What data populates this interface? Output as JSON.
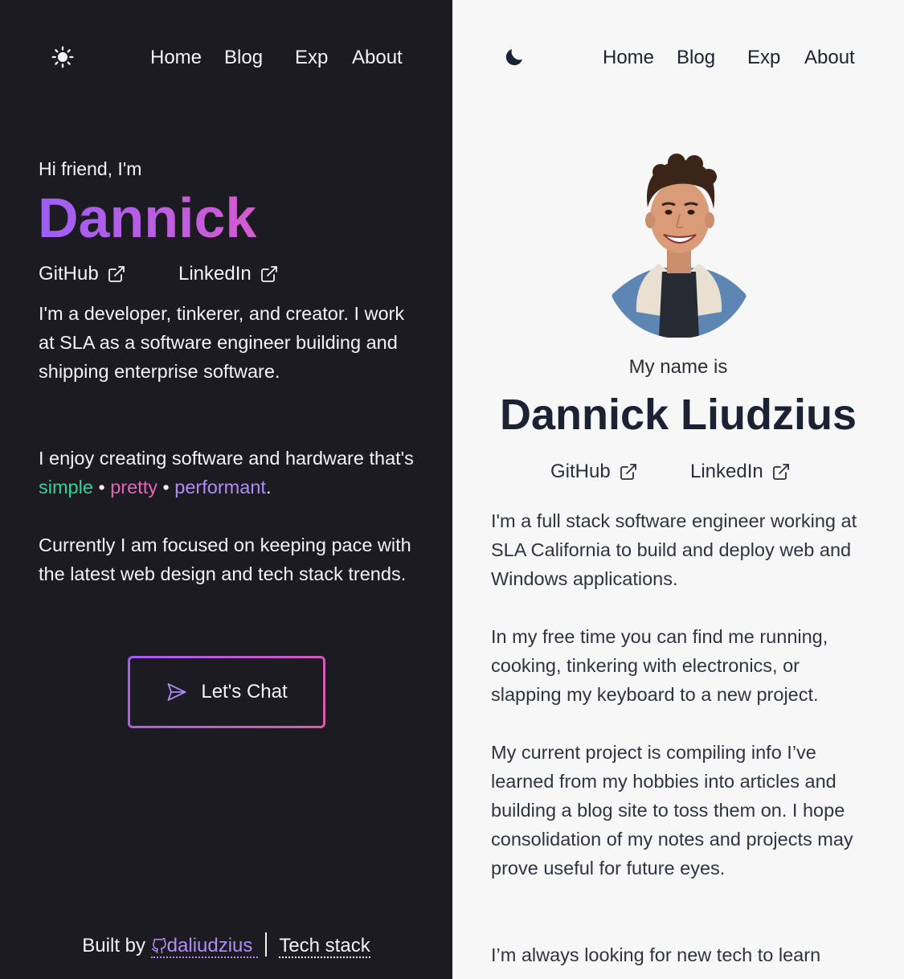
{
  "dark_panel": {
    "theme_toggle_icon": "sun-icon",
    "nav": [
      "Home",
      "Blog",
      "Exp",
      "About"
    ],
    "greeting": "Hi friend, I'm",
    "name": "Dannick",
    "links": [
      {
        "label": "GitHub",
        "icon": "external-link-icon"
      },
      {
        "label": "LinkedIn",
        "icon": "external-link-icon"
      }
    ],
    "bio": "I'm a developer, tinkerer, and creator. I work at SLA as a software engineer building and shipping enterprise software.",
    "enjoy_prefix": "I enjoy creating software and hardware that's",
    "qualities": [
      "simple",
      "pretty",
      "performant"
    ],
    "quality_separator": "•",
    "enjoy_suffix": ".",
    "focus": "Currently I am focused on keeping pace with the latest web design and tech stack trends.",
    "cta": {
      "label": "Let's Chat",
      "icon": "send-icon"
    },
    "footer": {
      "built_by": "Built by",
      "github_user": "daliudzius",
      "github_icon": "github-icon",
      "tech_stack": "Tech stack"
    }
  },
  "light_panel": {
    "theme_toggle_icon": "moon-icon",
    "nav": [
      "Home",
      "Blog",
      "Exp",
      "About"
    ],
    "intro": "My name is",
    "full_name": "Dannick Liudzius",
    "links": [
      {
        "label": "GitHub",
        "icon": "external-link-icon"
      },
      {
        "label": "LinkedIn",
        "icon": "external-link-icon"
      }
    ],
    "paragraphs": [
      "I'm a full stack software engineer working at SLA California to build and deploy web and Windows applications.",
      "In my free time you can find me running, cooking, tinkering with electronics, or slapping my keyboard to a new project.",
      "My current project is compiling info I’ve learned from my hobbies into articles and building a blog site to toss them on. I hope consolidation of my notes and projects may prove useful for future eyes.",
      "I’m always looking for new tech to learn"
    ]
  },
  "colors": {
    "dark_bg": "#1c1b21",
    "light_bg": "#f7f7f8",
    "gradient_start": "#9d5ff5",
    "gradient_end": "#d35cd0",
    "simple": "#2fd49a",
    "pretty": "#e465b6",
    "performant": "#b18cf6"
  }
}
